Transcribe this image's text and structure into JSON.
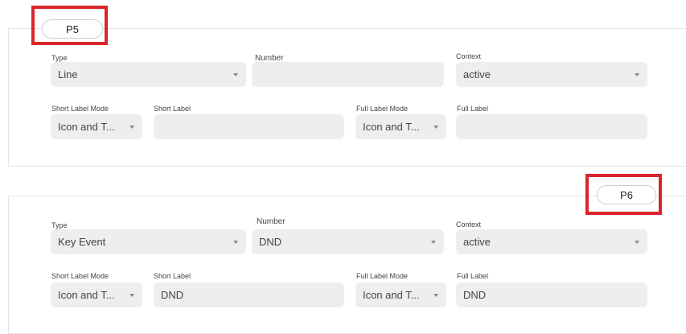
{
  "cards": {
    "p5": {
      "badge": "P5",
      "type_label": "Type",
      "type_value": "Line",
      "number_label": "Number",
      "number_value": "",
      "context_label": "Context",
      "context_value": "active",
      "short_mode_label": "Short Label Mode",
      "short_mode_value": "Icon and T...",
      "short_label_label": "Short Label",
      "short_label_value": "",
      "full_mode_label": "Full Label Mode",
      "full_mode_value": "Icon and T...",
      "full_label_label": "Full Label",
      "full_label_value": ""
    },
    "p6": {
      "badge": "P6",
      "type_label": "Type",
      "type_value": "Key Event",
      "number_label": "Number",
      "number_value": "DND",
      "context_label": "Context",
      "context_value": "active",
      "short_mode_label": "Short Label Mode",
      "short_mode_value": "Icon and T...",
      "short_label_label": "Short Label",
      "short_label_value": "DND",
      "full_mode_label": "Full Label Mode",
      "full_mode_value": "Icon and T...",
      "full_label_label": "Full Label",
      "full_label_value": "DND"
    }
  },
  "colors": {
    "highlight": "#d9262c",
    "field_bg": "#eeeeee"
  },
  "icons": {
    "dropdown": "caret-down-icon"
  }
}
